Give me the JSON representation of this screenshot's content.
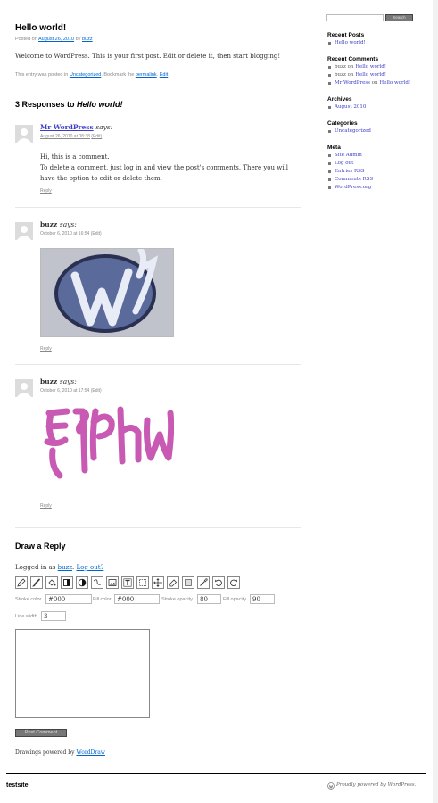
{
  "post": {
    "title": "Hello world!",
    "meta_posted": "Posted on",
    "meta_date": "August 26, 2010",
    "meta_by": "by",
    "meta_author": "buzz",
    "body": "Welcome to WordPress. This is your first post. Edit or delete it, then start blogging!",
    "util_prefix": "This entry was posted in",
    "util_category": "Uncategorized",
    "util_bookmark": ". Bookmark the",
    "util_permalink": "permalink",
    "util_edit": "Edit"
  },
  "responses": {
    "prefix": "3 Responses to",
    "title": "Hello world!"
  },
  "comments": [
    {
      "author": "Mr WordPress",
      "says": "says:",
      "date": "August 26, 2010 at 08:38",
      "edit": "(Edit)",
      "lines": [
        "Hi, this is a comment.",
        "To delete a comment, just log in and view the post's comments. There you will",
        "have the option to edit or delete them."
      ],
      "reply": "Reply"
    },
    {
      "author": "buzz",
      "says": "says:",
      "date": "October 6, 2010 at 16:54",
      "edit": "(Edit)",
      "reply": "Reply"
    },
    {
      "author": "buzz",
      "says": "says:",
      "date": "October 6, 2010 at 17:54",
      "edit": "(Edit)",
      "reply": "Reply"
    }
  ],
  "reply": {
    "title": "Draw a Reply",
    "logged_in_prefix": "Logged in as",
    "user": "buzz",
    "logout": "Log out?",
    "tools": [
      "pencil-icon",
      "brush-icon",
      "fill-bucket-icon",
      "rectangle-icon",
      "ellipse-icon",
      "curve-icon",
      "image-icon",
      "text-icon",
      "selection-icon",
      "move-icon",
      "eraser-icon",
      "clear-icon",
      "eyedropper-icon",
      "undo-icon",
      "redo-icon"
    ],
    "stroke_color_label": "Stroke color",
    "stroke_color": "#000",
    "fill_color_label": "Fill color",
    "fill_color": "#000",
    "stroke_opacity_label": "Stroke opacity",
    "stroke_opacity": "80",
    "fill_opacity_label": "Fill opacity",
    "fill_opacity": "90",
    "line_width_label": "Line width",
    "line_width": "3",
    "submit": "Post Comment",
    "drawings_by": "Drawings powered by",
    "drawings_link": "WordDraw"
  },
  "sidebar": {
    "search_button": "Search",
    "recent_posts_title": "Recent Posts",
    "recent_posts": [
      "Hello world!"
    ],
    "recent_comments_title": "Recent Comments",
    "recent_comments": [
      {
        "author": "buzz",
        "on": "on",
        "post": "Hello world!"
      },
      {
        "author": "buzz",
        "on": "on",
        "post": "Hello world!"
      },
      {
        "author": "Mr WordPress",
        "on": "on",
        "post": "Hello world!"
      }
    ],
    "archives_title": "Archives",
    "archives": [
      "August 2010"
    ],
    "categories_title": "Categories",
    "categories": [
      "Uncategorized"
    ],
    "meta_title": "Meta",
    "meta": [
      "Site Admin",
      "Log out",
      "Entries RSS",
      "Comments RSS",
      "WordPress.org"
    ]
  },
  "footer": {
    "site_name": "testsite",
    "powered": "Proudly powered by WordPress."
  },
  "colors": {
    "link": "#0066cc",
    "drawing_purple": "#c85ab4",
    "drawing_blue": "#4a5a8c"
  }
}
